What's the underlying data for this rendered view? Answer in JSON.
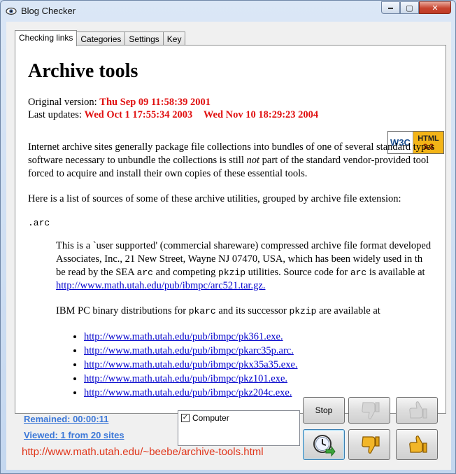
{
  "window": {
    "title": "Blog Checker",
    "caption_minimize": "▬",
    "caption_maximize": "▢",
    "caption_close": "✕"
  },
  "tabs": [
    "Checking links",
    "Categories",
    "Settings",
    "Key"
  ],
  "page": {
    "heading": "Archive tools",
    "original_label": "Original version:",
    "original_date": "Thu Sep 09 11:58:39 2001",
    "updates_label": "Last updates:",
    "update_1": "Wed Oct 1 17:55:34 2003",
    "update_2": "Wed Nov 10 18:29:23 2004",
    "badge_w3c": "W3C",
    "badge_html": "HTML",
    "badge_version": "3.2",
    "intro_line1": "Internet archive sites generally package file collections into bundles of one of several standard types",
    "intro_line2_a": "software necessary to unbundle the collections is still ",
    "intro_line2_em": "not",
    "intro_line2_b": " part of the standard vendor-provided tool",
    "intro_line3": "forced to acquire and install their own copies of these essential tools.",
    "list_intro": "Here is a list of sources of some of these archive utilities, grouped by archive file extension:",
    "ext": ".arc",
    "arc_line1": "This is a `user supported' (commercial shareware) compressed archive file format developed",
    "arc_line2": "Associates, Inc., 21 New Street, Wayne NJ 07470, USA, which has been widely used in th",
    "arc_line3_a": "be read by the SEA ",
    "arc_line3_code1": "arc",
    "arc_line3_b": " and competing ",
    "arc_line3_code2": "pkzip",
    "arc_line3_c": " utilities. Source code for ",
    "arc_line3_code3": "arc",
    "arc_line3_d": " is available at",
    "arc_source_link": "http://www.math.utah.edu/pub/ibmpc/arc521.tar.gz.",
    "ibm_a": "IBM PC binary distributions for ",
    "ibm_code1": "pkarc",
    "ibm_b": " and its successor ",
    "ibm_code2": "pkzip",
    "ibm_c": " are available at",
    "links": [
      "http://www.math.utah.edu/pub/ibmpc/pk361.exe.",
      "http://www.math.utah.edu/pub/ibmpc/pkarc35p.arc.",
      "http://www.math.utah.edu/pub/ibmpc/pkx35a35.exe.",
      "http://www.math.utah.edu/pub/ibmpc/pkz101.exe.",
      "http://www.math.utah.edu/pub/ibmpc/pkz204c.exe."
    ]
  },
  "status": {
    "remained": "Remained: 00:00:11",
    "viewed": "Viewed: 1 from 20 sites",
    "url": "http://www.math.utah.edu/~beebe/archive-tools.html"
  },
  "listbox": {
    "item": "Computer",
    "checked": true,
    "checkmark": "✓"
  },
  "buttons": {
    "stop": "Stop"
  },
  "colors": {
    "accent_link": "#3c78d8",
    "url_red": "#e0351a",
    "date_red": "#e01010",
    "thumb_gold": "#f2b629"
  },
  "icons": {
    "thumb_down_disabled": "thumb-down-icon",
    "thumb_up_disabled": "thumb-up-icon",
    "timer_next": "clock-arrow-icon",
    "thumb_down_active": "thumb-down-icon",
    "thumb_up_active": "thumb-up-icon"
  }
}
